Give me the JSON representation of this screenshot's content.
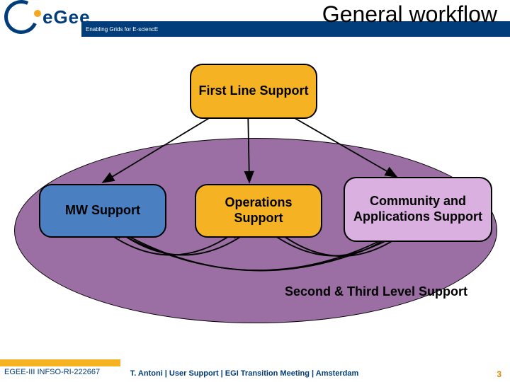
{
  "header": {
    "logo_text": "eGee",
    "tagline": "Enabling Grids for E-sciencE",
    "title": "General workflow"
  },
  "diagram": {
    "first_line": "First Line Support",
    "mw": "MW Support",
    "ops": "Operations Support",
    "ca": "Community and Applications Support",
    "second": "Second & Third Level Support"
  },
  "footer": {
    "left": "EGEE-III INFSO-RI-222667",
    "center": "T. Antoni | User Support | EGI Transition Meeting | Amsterdam",
    "page": "3"
  }
}
